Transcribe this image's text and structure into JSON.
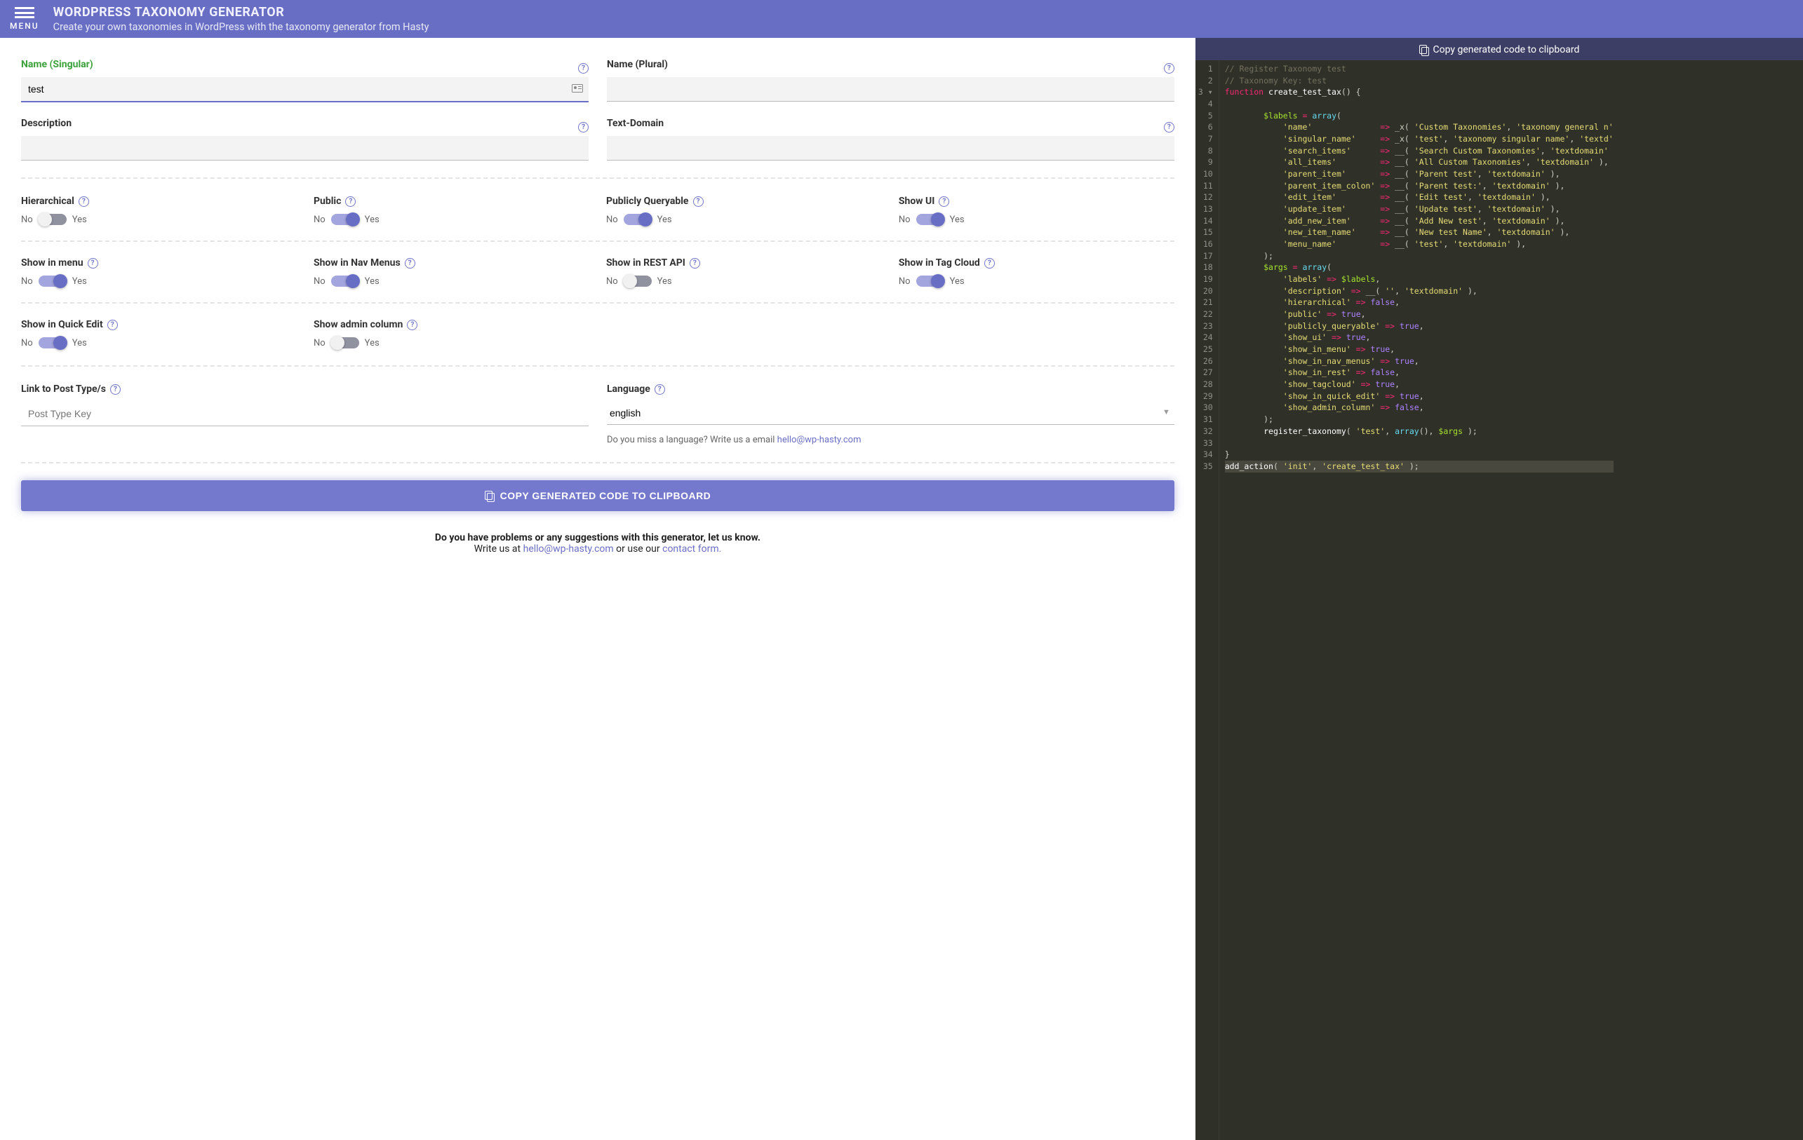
{
  "header": {
    "menu_label": "MENU",
    "title": "WORDPRESS TAXONOMY GENERATOR",
    "subtitle": "Create your own taxonomies in WordPress with the taxonomy generator from Hasty"
  },
  "fields": {
    "name_singular": {
      "label": "Name (Singular)",
      "value": "test"
    },
    "name_plural": {
      "label": "Name (Plural)",
      "value": ""
    },
    "description": {
      "label": "Description",
      "value": ""
    },
    "text_domain": {
      "label": "Text-Domain",
      "value": ""
    },
    "link_post_types": {
      "label": "Link to Post Type/s",
      "placeholder": "Post Type Key",
      "value": ""
    },
    "language": {
      "label": "Language",
      "value": "english",
      "hint_prefix": "Do you miss a language? Write us a email ",
      "hint_link": "hello@wp-hasty.com"
    }
  },
  "toggles": {
    "no": "No",
    "yes": "Yes",
    "hierarchical": {
      "label": "Hierarchical",
      "on": false
    },
    "public": {
      "label": "Public",
      "on": true
    },
    "publicly_queryable": {
      "label": "Publicly Queryable",
      "on": true
    },
    "show_ui": {
      "label": "Show UI",
      "on": true
    },
    "show_in_menu": {
      "label": "Show in menu",
      "on": true
    },
    "show_in_nav_menus": {
      "label": "Show in Nav Menus",
      "on": true
    },
    "show_in_rest": {
      "label": "Show in REST API",
      "on": false
    },
    "show_tag_cloud": {
      "label": "Show in Tag Cloud",
      "on": true
    },
    "show_in_quick_edit": {
      "label": "Show in Quick Edit",
      "on": true
    },
    "show_admin_column": {
      "label": "Show admin column",
      "on": false
    }
  },
  "buttons": {
    "copy_top": "Copy generated code to clipboard",
    "copy_big": "COPY GENERATED CODE TO CLIPBOARD"
  },
  "footer": {
    "line1": "Do you have problems or any suggestions with this generator, let us know.",
    "line2_a": "Write us at ",
    "line2_email": "hello@wp-hasty.com",
    "line2_b": " or use our ",
    "line2_link": "contact form."
  },
  "code": {
    "lines": [
      {
        "n": 1,
        "t": "cm",
        "s": "// Register Taxonomy test"
      },
      {
        "n": 2,
        "t": "cm",
        "s": "// Taxonomy Key: test"
      },
      {
        "n": 3,
        "t": "raw",
        "s": "<span class='kw'>function</span> <span class='fn'>create_test_tax</span>() {",
        "fold": true
      },
      {
        "n": 4,
        "t": "raw",
        "s": ""
      },
      {
        "n": 5,
        "t": "raw",
        "s": "        <span class='var'>$labels</span> <span class='op'>=</span> <span class='id'>array</span>("
      },
      {
        "n": 6,
        "t": "raw",
        "s": "            <span class='str'>'name'</span>              <span class='op'>=&gt;</span> _x( <span class='str'>'Custom Taxonomies'</span>, <span class='str'>'taxonomy general n'</span>"
      },
      {
        "n": 7,
        "t": "raw",
        "s": "            <span class='str'>'singular_name'</span>     <span class='op'>=&gt;</span> _x( <span class='str'>'test'</span>, <span class='str'>'taxonomy singular name'</span>, <span class='str'>'textd'</span>"
      },
      {
        "n": 8,
        "t": "raw",
        "s": "            <span class='str'>'search_items'</span>      <span class='op'>=&gt;</span> __( <span class='str'>'Search Custom Taxonomies'</span>, <span class='str'>'textdomain'</span>"
      },
      {
        "n": 9,
        "t": "raw",
        "s": "            <span class='str'>'all_items'</span>         <span class='op'>=&gt;</span> __( <span class='str'>'All Custom Taxonomies'</span>, <span class='str'>'textdomain'</span> ),"
      },
      {
        "n": 10,
        "t": "raw",
        "s": "            <span class='str'>'parent_item'</span>       <span class='op'>=&gt;</span> __( <span class='str'>'Parent test'</span>, <span class='str'>'textdomain'</span> ),"
      },
      {
        "n": 11,
        "t": "raw",
        "s": "            <span class='str'>'parent_item_colon'</span> <span class='op'>=&gt;</span> __( <span class='str'>'Parent test:'</span>, <span class='str'>'textdomain'</span> ),"
      },
      {
        "n": 12,
        "t": "raw",
        "s": "            <span class='str'>'edit_item'</span>         <span class='op'>=&gt;</span> __( <span class='str'>'Edit test'</span>, <span class='str'>'textdomain'</span> ),"
      },
      {
        "n": 13,
        "t": "raw",
        "s": "            <span class='str'>'update_item'</span>       <span class='op'>=&gt;</span> __( <span class='str'>'Update test'</span>, <span class='str'>'textdomain'</span> ),"
      },
      {
        "n": 14,
        "t": "raw",
        "s": "            <span class='str'>'add_new_item'</span>      <span class='op'>=&gt;</span> __( <span class='str'>'Add New test'</span>, <span class='str'>'textdomain'</span> ),"
      },
      {
        "n": 15,
        "t": "raw",
        "s": "            <span class='str'>'new_item_name'</span>     <span class='op'>=&gt;</span> __( <span class='str'>'New test Name'</span>, <span class='str'>'textdomain'</span> ),"
      },
      {
        "n": 16,
        "t": "raw",
        "s": "            <span class='str'>'menu_name'</span>         <span class='op'>=&gt;</span> __( <span class='str'>'test'</span>, <span class='str'>'textdomain'</span> ),"
      },
      {
        "n": 17,
        "t": "raw",
        "s": "        );"
      },
      {
        "n": 18,
        "t": "raw",
        "s": "        <span class='var'>$args</span> <span class='op'>=</span> <span class='id'>array</span>("
      },
      {
        "n": 19,
        "t": "raw",
        "s": "            <span class='str'>'labels'</span> <span class='op'>=&gt;</span> <span class='var'>$labels</span>,"
      },
      {
        "n": 20,
        "t": "raw",
        "s": "            <span class='str'>'description'</span> <span class='op'>=&gt;</span> __( <span class='str'>''</span>, <span class='str'>'textdomain'</span> ),"
      },
      {
        "n": 21,
        "t": "raw",
        "s": "            <span class='str'>'hierarchical'</span> <span class='op'>=&gt;</span> <span class='num'>false</span>,"
      },
      {
        "n": 22,
        "t": "raw",
        "s": "            <span class='str'>'public'</span> <span class='op'>=&gt;</span> <span class='num'>true</span>,"
      },
      {
        "n": 23,
        "t": "raw",
        "s": "            <span class='str'>'publicly_queryable'</span> <span class='op'>=&gt;</span> <span class='num'>true</span>,"
      },
      {
        "n": 24,
        "t": "raw",
        "s": "            <span class='str'>'show_ui'</span> <span class='op'>=&gt;</span> <span class='num'>true</span>,"
      },
      {
        "n": 25,
        "t": "raw",
        "s": "            <span class='str'>'show_in_menu'</span> <span class='op'>=&gt;</span> <span class='num'>true</span>,"
      },
      {
        "n": 26,
        "t": "raw",
        "s": "            <span class='str'>'show_in_nav_menus'</span> <span class='op'>=&gt;</span> <span class='num'>true</span>,"
      },
      {
        "n": 27,
        "t": "raw",
        "s": "            <span class='str'>'show_in_rest'</span> <span class='op'>=&gt;</span> <span class='num'>false</span>,"
      },
      {
        "n": 28,
        "t": "raw",
        "s": "            <span class='str'>'show_tagcloud'</span> <span class='op'>=&gt;</span> <span class='num'>true</span>,"
      },
      {
        "n": 29,
        "t": "raw",
        "s": "            <span class='str'>'show_in_quick_edit'</span> <span class='op'>=&gt;</span> <span class='num'>true</span>,"
      },
      {
        "n": 30,
        "t": "raw",
        "s": "            <span class='str'>'show_admin_column'</span> <span class='op'>=&gt;</span> <span class='num'>false</span>,"
      },
      {
        "n": 31,
        "t": "raw",
        "s": "        );"
      },
      {
        "n": 32,
        "t": "raw",
        "s": "        <span class='fn'>register_taxonomy</span>( <span class='str'>'test'</span>, <span class='id'>array</span>(), <span class='var'>$args</span> );"
      },
      {
        "n": 33,
        "t": "raw",
        "s": ""
      },
      {
        "n": 34,
        "t": "raw",
        "s": "}"
      },
      {
        "n": 35,
        "t": "raw",
        "s": "<span class='fn'>add_action</span>( <span class='str'>'init'</span>, <span class='str'>'create_test_tax'</span> );",
        "hl": true
      }
    ]
  }
}
